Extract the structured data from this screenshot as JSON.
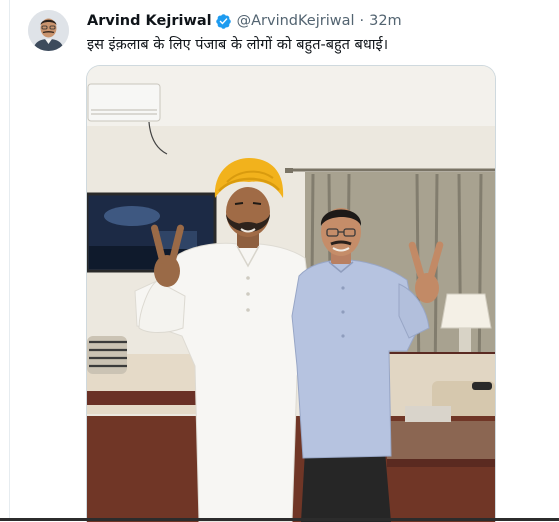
{
  "tweet": {
    "display_name": "Arvind Kejriwal",
    "handle": "@ArvindKejriwal",
    "separator": "·",
    "time": "32m",
    "text": "इस इंक़लाब के लिए पंजाब के लोगों को बहुत-बहुत बधाई।",
    "verified": true
  },
  "colors": {
    "verified_blue": "#1d9bf0",
    "text_primary": "#0f1419",
    "text_secondary": "#536471",
    "border": "#cfd9de"
  },
  "icons": {
    "verified": "verified-badge-icon"
  }
}
